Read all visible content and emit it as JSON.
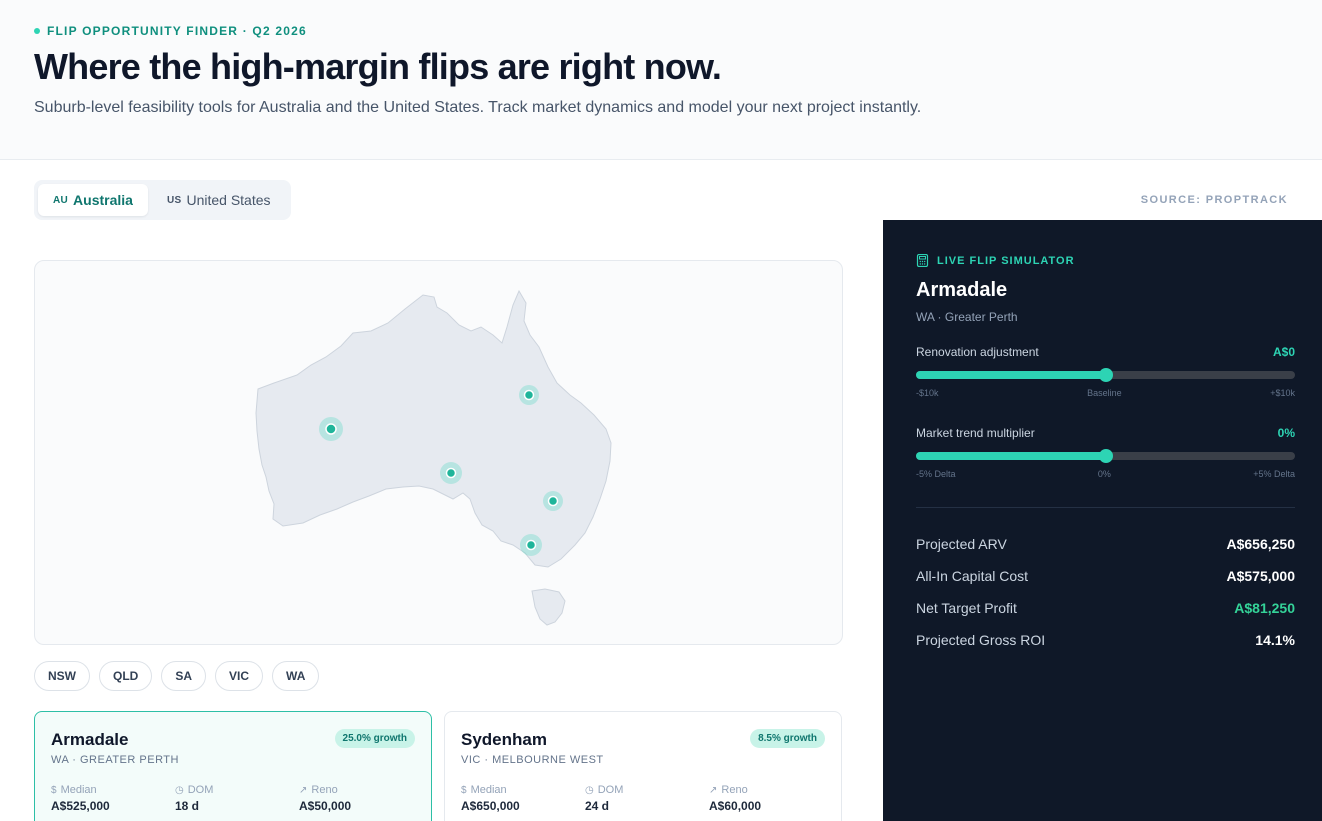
{
  "header": {
    "eyebrow": "FLIP OPPORTUNITY FINDER · Q2 2026",
    "title": "Where the high-margin flips are right now.",
    "subtitle": "Suburb-level feasibility tools for Australia and the United States. Track market dynamics and model your next project instantly."
  },
  "tabs": [
    {
      "code": "AU",
      "label": "Australia",
      "active": true
    },
    {
      "code": "US",
      "label": "United States",
      "active": false
    }
  ],
  "source": "SOURCE: PROPTRACK",
  "map": {
    "markers": [
      "WA",
      "QLD",
      "SA",
      "NSW",
      "VIC"
    ]
  },
  "state_filters": [
    "NSW",
    "QLD",
    "SA",
    "VIC",
    "WA"
  ],
  "cards": [
    {
      "name": "Armadale",
      "region": "WA · GREATER PERTH",
      "growth": "25.0% growth",
      "median_label": "Median",
      "median": "A$525,000",
      "dom_label": "DOM",
      "dom": "18 d",
      "reno_label": "Reno",
      "reno": "A$50,000"
    },
    {
      "name": "Sydenham",
      "region": "VIC · MELBOURNE WEST",
      "growth": "8.5% growth",
      "median_label": "Median",
      "median": "A$650,000",
      "dom_label": "DOM",
      "dom": "24 d",
      "reno_label": "Reno",
      "reno": "A$60,000"
    }
  ],
  "simulator": {
    "title": "LIVE FLIP SIMULATOR",
    "suburb": "Armadale",
    "region": "WA · Greater Perth",
    "reno": {
      "label": "Renovation adjustment",
      "value": "A$0",
      "position": 0.5,
      "min": "-$10k",
      "mid": "Baseline",
      "max": "+$10k"
    },
    "trend": {
      "label": "Market trend multiplier",
      "value": "0%",
      "position": 0.5,
      "min": "-5% Delta",
      "mid": "0%",
      "max": "+5% Delta"
    },
    "results": [
      {
        "label": "Projected ARV",
        "value": "A$656,250"
      },
      {
        "label": "All-In Capital Cost",
        "value": "A$575,000"
      },
      {
        "label": "Net Target Profit",
        "value": "A$81,250"
      },
      {
        "label": "Projected Gross ROI",
        "value": "14.1%"
      }
    ]
  },
  "colors": {
    "accent": "#2dd4b4",
    "panel": "#0f1828",
    "positive": "#34d399"
  }
}
